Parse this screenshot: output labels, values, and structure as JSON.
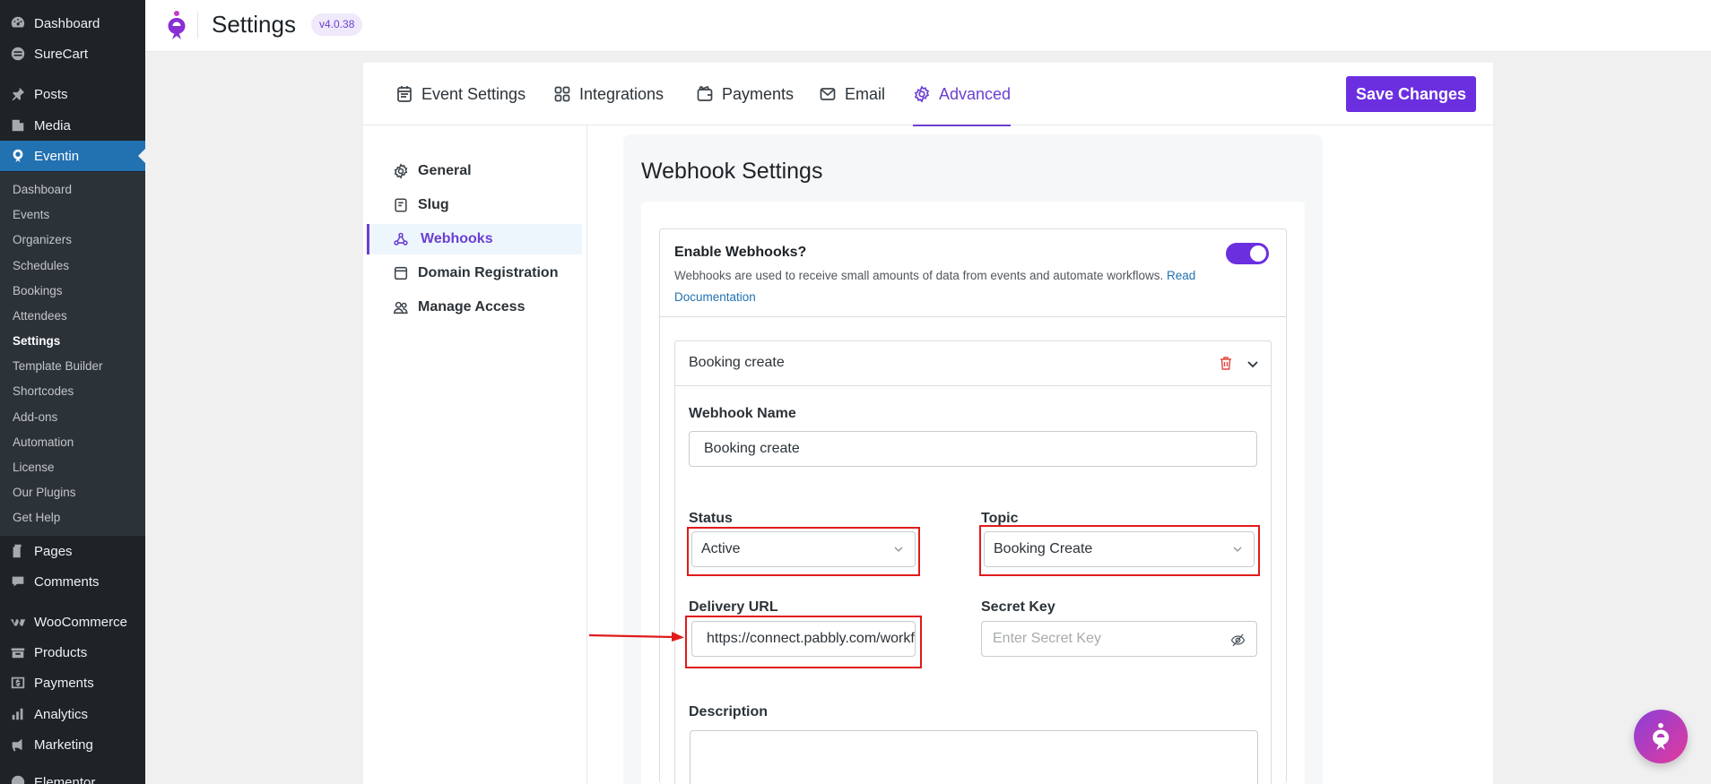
{
  "wp_menu": {
    "top": [
      {
        "label": "Dashboard",
        "icon": "dashboard-icon"
      },
      {
        "label": "SureCart",
        "icon": "surecart-icon"
      },
      {
        "label": "Posts",
        "icon": "pin-icon"
      },
      {
        "label": "Media",
        "icon": "media-icon"
      },
      {
        "label": "Eventin",
        "icon": "eventin-icon"
      }
    ],
    "submenu": [
      "Dashboard",
      "Events",
      "Organizers",
      "Schedules",
      "Bookings",
      "Attendees",
      "Settings",
      "Template Builder",
      "Shortcodes",
      "Add-ons",
      "Automation",
      "License",
      "Our Plugins",
      "Get Help"
    ],
    "bottom": [
      {
        "label": "Pages",
        "icon": "pages-icon"
      },
      {
        "label": "Comments",
        "icon": "comments-icon"
      },
      {
        "label": "WooCommerce",
        "icon": "woocommerce-icon"
      },
      {
        "label": "Products",
        "icon": "products-icon"
      },
      {
        "label": "Payments",
        "icon": "payments-icon"
      },
      {
        "label": "Analytics",
        "icon": "analytics-icon"
      },
      {
        "label": "Marketing",
        "icon": "marketing-icon"
      },
      {
        "label": "Elementor",
        "icon": "elementor-icon"
      }
    ]
  },
  "header": {
    "title": "Settings",
    "version": "v4.0.38"
  },
  "tabs": [
    {
      "label": "Event Settings",
      "icon": "calendar-list-icon"
    },
    {
      "label": "Integrations",
      "icon": "grid-icon"
    },
    {
      "label": "Payments",
      "icon": "wallet-icon"
    },
    {
      "label": "Email",
      "icon": "envelope-icon"
    },
    {
      "label": "Advanced",
      "icon": "gear-icon",
      "active": true
    }
  ],
  "save_label": "Save Changes",
  "sidenav": [
    {
      "label": "General",
      "icon": "gear-icon"
    },
    {
      "label": "Slug",
      "icon": "document-icon"
    },
    {
      "label": "Webhooks",
      "icon": "webhook-icon",
      "active": true
    },
    {
      "label": "Domain Registration",
      "icon": "window-icon"
    },
    {
      "label": "Manage Access",
      "icon": "users-icon"
    }
  ],
  "webhook_settings": {
    "title": "Webhook Settings",
    "enable_label": "Enable Webhooks?",
    "enable_desc": "Webhooks are used to receive small amounts of data from events and automate workflows.",
    "read_doc": "Read Documentation",
    "enabled": true,
    "webhook": {
      "header_title": "Booking create",
      "name_label": "Webhook Name",
      "name_value": "Booking create",
      "status_label": "Status",
      "status_value": "Active",
      "topic_label": "Topic",
      "topic_value": "Booking Create",
      "url_label": "Delivery URL",
      "url_value": "https://connect.pabbly.com/workflow/s",
      "secret_label": "Secret Key",
      "secret_placeholder": "Enter Secret Key",
      "description_label": "Description"
    }
  },
  "colors": {
    "accent": "#6b2fe0",
    "wp_sidebar": "#1d2327",
    "wp_current": "#2271b1",
    "annotation_red": "#e01b1b"
  }
}
